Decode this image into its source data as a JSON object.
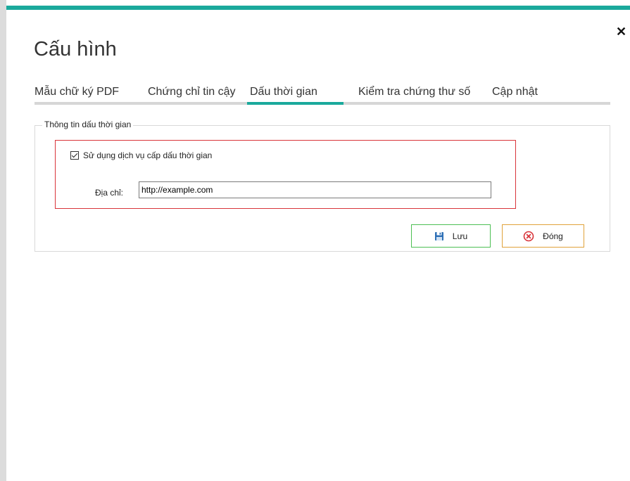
{
  "dialog": {
    "title": "Cấu hình",
    "close_glyph": "✕"
  },
  "tabs": [
    {
      "label": "Mẫu chữ ký PDF",
      "active": false
    },
    {
      "label": "Chứng chỉ tin cậy",
      "active": false
    },
    {
      "label": "Dấu thời gian",
      "active": true
    },
    {
      "label": "Kiểm tra chứng thư số",
      "active": false
    },
    {
      "label": "Cập nhật",
      "active": false
    }
  ],
  "timestamp_group": {
    "legend": "Thông tin dấu thời gian",
    "use_service_label": "Sử dụng dịch vụ cấp dấu thời gian",
    "use_service_checked": true,
    "address_label": "Địa chỉ:",
    "address_value": "http://example.com"
  },
  "buttons": {
    "save_label": "Lưu",
    "save_icon": "floppy-disk-icon",
    "close_label": "Đóng",
    "close_icon": "circle-x-icon"
  },
  "colors": {
    "accent": "#1aa99c",
    "highlight_border": "#d9343a",
    "save_border": "#4cbf53",
    "close_border": "#e0a23a"
  }
}
